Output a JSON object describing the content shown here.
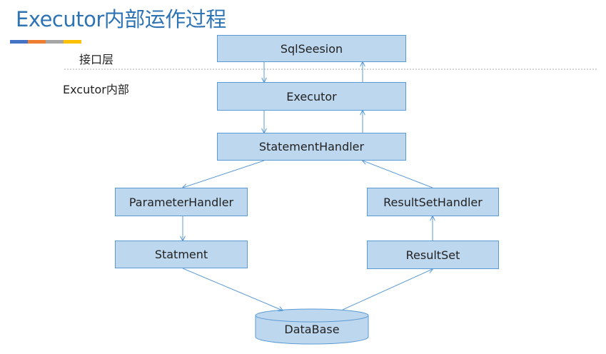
{
  "title": "Executor内部运作过程",
  "accent_colors": [
    "#4472c4",
    "#ed7d31",
    "#a5a5a5",
    "#ffc000"
  ],
  "layers": {
    "interface": "接口层",
    "executor_internal": "Excutor内部"
  },
  "nodes": {
    "sqlsession": "SqlSeesion",
    "executor": "Executor",
    "statement_handler": "StatementHandler",
    "parameter_handler": "ParameterHandler",
    "result_set_handler": "ResultSetHandler",
    "statement": "Statment",
    "result_set": "ResultSet",
    "database": "DataBase"
  },
  "colors": {
    "box_fill": "#bdd7ee",
    "box_border": "#5b9bd5",
    "arrow": "#5b9bd5",
    "title": "#2e74b5"
  }
}
